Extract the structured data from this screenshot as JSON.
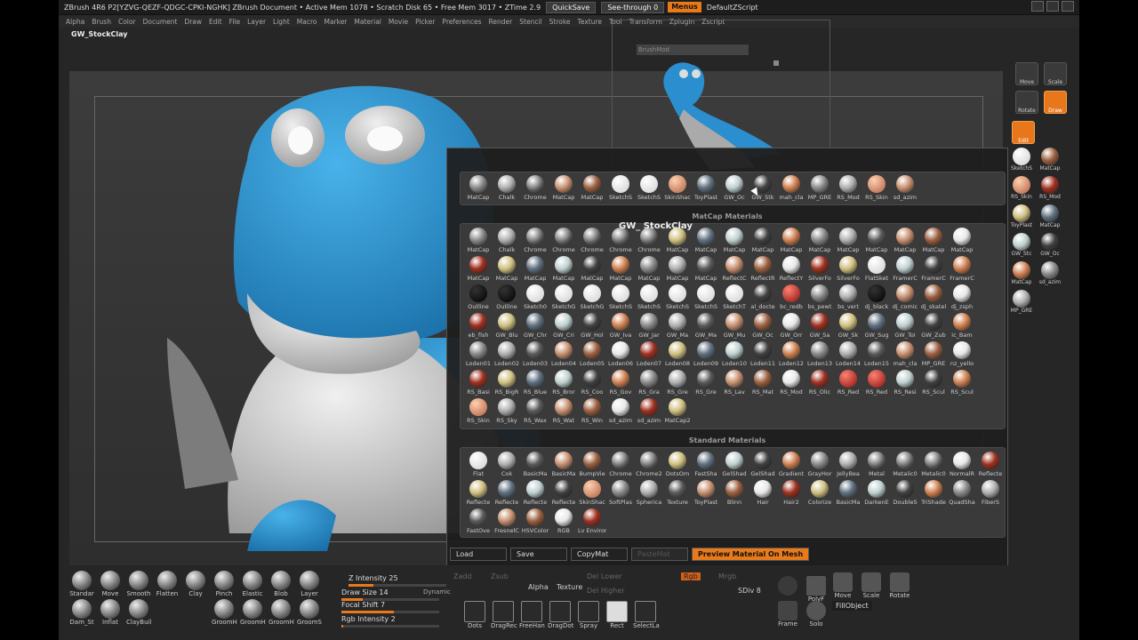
{
  "titlebar": {
    "title": "ZBrush 4R6 P2[YZVG-QEZF-QDGC-CPKI-NGHK]   ZBrush Document   • Active Mem 1078 • Scratch Disk 65 • Free Mem 3017 • ZTime 2.9",
    "quicksave": "QuickSave",
    "seethrough": "See-through  0",
    "menus": "Menus",
    "zscript": "DefaultZScript"
  },
  "menubar": [
    "Alpha",
    "Brush",
    "Color",
    "Document",
    "Draw",
    "Edit",
    "File",
    "Layer",
    "Light",
    "Macro",
    "Marker",
    "Material",
    "Movie",
    "Picker",
    "Preferences",
    "Render",
    "Stencil",
    "Stroke",
    "Texture",
    "Tool",
    "Transform",
    "Zplugin",
    "Zscript"
  ],
  "current_material": "GW_StockClay",
  "brushmod_label": "BrushMod",
  "tooltip": "GW_ StockClay",
  "right_shelf": {
    "buttons": [
      "Move",
      "Scale",
      "Rotate",
      "Draw",
      "Edit"
    ],
    "materials": [
      "SketchS",
      "MatCap",
      "RS_Skin",
      "RS_Mod",
      "ToyPlast",
      "MatCap",
      "GW_Stc",
      "GW_Oc",
      "MatCap",
      "sd_azim",
      "MP_GRE"
    ]
  },
  "popup": {
    "recent": [
      "MatCap",
      "Chalk",
      "Chrome",
      "MatCap",
      "MatCap",
      "SketchS",
      "SketchS",
      "SkinShac",
      "ToyPlast",
      "GW_Oc",
      "GW_Stk",
      "mah_cla",
      "MP_GRE",
      "RS_Mod",
      "RS_Skin",
      "sd_azim"
    ],
    "matcap_title": "MatCap Materials",
    "matcap": [
      "MatCap",
      "Chalk",
      "Chrome",
      "Chrome",
      "Chrome",
      "Chrome",
      "Chrome",
      "MatCap",
      "MatCap",
      "MatCap",
      "MatCap",
      "MatCap",
      "MatCap",
      "MatCap",
      "MatCap",
      "MatCap",
      "MatCap",
      "MatCap",
      "MatCap",
      "MatCap",
      "MatCap",
      "MatCap",
      "MatCap",
      "MatCap",
      "MatCap",
      "MatCap",
      "MatCap",
      "ReflectC",
      "ReflectR",
      "ReflectY",
      "SilverFo",
      "SilverFo",
      "FlatSket",
      "FramerC",
      "FramerC",
      "FramerC",
      "Outline",
      "Outline",
      "Sketch0",
      "SketchG",
      "SketchG",
      "SketchS",
      "SketchS",
      "SketchS",
      "SketchS",
      "SketchT",
      "al_docte",
      "bc_redb",
      "bs_pewt",
      "bs_vert",
      "dj_black",
      "dj_comic",
      "dj_skatel",
      "dj_zsph",
      "eb_fish",
      "GW_Blu",
      "GW_Chr",
      "GW_Cri",
      "GW_Hol",
      "GW_Iva",
      "GW_Jar",
      "GW_Ma",
      "GW_Ma",
      "GW_Mu",
      "GW_Oc",
      "GW_Orr",
      "GW_Sa",
      "GW_Sk",
      "GW_Sug",
      "GW_Toi",
      "GW_Zub",
      "ic_Bam",
      "Loden01",
      "Loden02",
      "Loden03",
      "Loden04",
      "Loden05",
      "Loden06",
      "Loden07",
      "Loden08",
      "Loden09",
      "Loden10",
      "Loden11",
      "Loden12",
      "Loden13",
      "Loden14",
      "Loden15",
      "mah_cla",
      "MP_GRE",
      "nz_yello",
      "RS_Basi",
      "RS_BigR",
      "RS_Blue",
      "RS_Bror",
      "RS_Coo",
      "RS_Gov",
      "RS_Gra",
      "RS_Gre",
      "RS_Gre",
      "RS_Lav",
      "RS_Mat",
      "RS_Mod",
      "RS_Olic",
      "RS_Red",
      "RS_Red",
      "RS_Resi",
      "RS_Scul",
      "RS_Scul",
      "RS_Skin",
      "RS_Sky",
      "RS_Wax",
      "RS_Wat",
      "RS_Win",
      "sd_azim",
      "sd_azim",
      "MatCap2"
    ],
    "standard_title": "Standard Materials",
    "standard": [
      "Flat",
      "Cok",
      "BasicMa",
      "BasicMa",
      "BumpVie",
      "Chrome",
      "Chrome2",
      "DotsOm",
      "FastSha",
      "GelShad",
      "GelShad",
      "Gradient",
      "GrayHor",
      "JellyBea",
      "Metal",
      "Metalic0",
      "Metalic0",
      "NormalR",
      "Reflecte",
      "Reflecte",
      "Reflecte",
      "Reflecte",
      "Reflecte",
      "SkinShac",
      "SoftPlas",
      "Spherica",
      "Texture",
      "ToyPlast",
      "Blinn",
      "Hair",
      "Hair2",
      "Colorize",
      "BasicMa",
      "DarkenE",
      "DoubleS",
      "TriShade",
      "QuadSha",
      "FiberS",
      "FastOve",
      "FresnelC",
      "HSVColor",
      "RGB",
      "Lv Environ"
    ],
    "bottom": {
      "load": "Load",
      "save": "Save",
      "copy": "CopyMat",
      "paste": "PasteMat",
      "preview": "Preview Material On Mesh"
    }
  },
  "bottom_tray": {
    "brushes": [
      "Standar",
      "Move",
      "Smooth",
      "Flatten",
      "Clay",
      "Pinch",
      "Elastic",
      "Blob",
      "Layer",
      "Dam_St",
      "Inflat",
      "ClayBuil",
      "GroomH",
      "GroomH",
      "GroomH",
      "GroomS"
    ],
    "zintensity_label": "Z Intensity 25",
    "zintensity": 25,
    "drawsize_label": "Draw Size 14",
    "drawsize": 14,
    "dynamic": "Dynamic",
    "focal_label": "Focal Shift 7",
    "focal": 7,
    "rgb_label": "Rgb Intensity 2",
    "rgb": 2,
    "zadd": "Zadd",
    "zsub": "Zsub",
    "rgb_btn": "Rgb",
    "mrgb": "Mrgb",
    "alpha": "Alpha",
    "texture": "Texture",
    "dellower": "Del Lower",
    "delhigher": "Del Higher",
    "strokes": [
      "Dots",
      "DragRec",
      "FreeHan",
      "DragDot",
      "Spray",
      "Rect",
      "SelectLa"
    ],
    "sdiv": "SDiv 8",
    "polyf": "PolyF",
    "move": "Move",
    "scale": "Scale",
    "rotate": "Rotate",
    "frame": "Frame",
    "solo": "Solo",
    "fillobject": "FillObject"
  }
}
